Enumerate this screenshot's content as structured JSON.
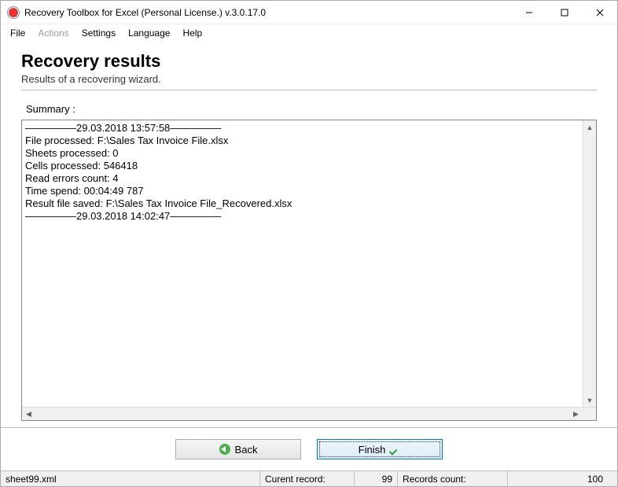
{
  "window": {
    "title": "Recovery Toolbox for Excel (Personal License.) v.3.0.17.0"
  },
  "menu": {
    "file": "File",
    "actions": "Actions",
    "settings": "Settings",
    "language": "Language",
    "help": "Help"
  },
  "page": {
    "heading": "Recovery results",
    "subheading": "Results of a recovering wizard.",
    "summary_label": "Summary :"
  },
  "log": {
    "text": "—————29.03.2018 13:57:58—————\nFile processed: F:\\Sales Tax Invoice File.xlsx\nSheets processed: 0\nCells processed: 546418\nRead errors count: 4\nTime spend: 00:04:49 787\nResult file saved: F:\\Sales Tax Invoice File_Recovered.xlsx\n—————29.03.2018 14:02:47—————"
  },
  "buttons": {
    "back": "Back",
    "finish": "Finish"
  },
  "status": {
    "file": "sheet99.xml",
    "current_label": "Curent record:",
    "current_value": "99",
    "count_label": "Records count:",
    "count_value": "100"
  }
}
